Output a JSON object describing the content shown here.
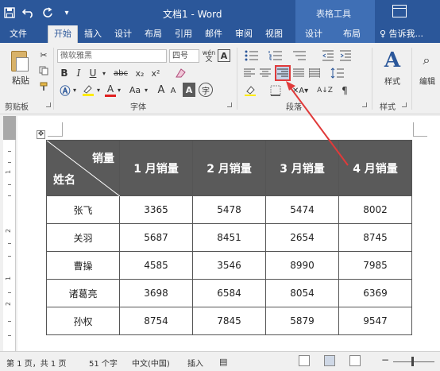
{
  "titlebar": {
    "doc_title": "文档1 - Word",
    "context_title": "表格工具",
    "qat_icons": [
      "save-icon",
      "undo-icon",
      "redo-icon",
      "qat-more-icon"
    ]
  },
  "tabs": [
    "文件",
    "开始",
    "插入",
    "设计",
    "布局",
    "引用",
    "邮件",
    "审阅",
    "视图",
    "设计",
    "布局"
  ],
  "tell_me": "♀ 告诉我...",
  "ribbon": {
    "paste_label": "粘贴",
    "font_name": "微软雅黑",
    "font_size": "四号",
    "bold": "B",
    "italic": "I",
    "underline": "U",
    "strike": "abc",
    "subscript": "x₂",
    "superscript": "x²",
    "font_color_letter": "A",
    "aa_label": "Aa",
    "grow_font": "A",
    "shrink_font": "A",
    "char_border": "A",
    "enclose_char": "字",
    "phonetic": "wén",
    "styles_label": "样式",
    "edit_label": "编辑",
    "groups": {
      "clipboard": "剪贴板",
      "font": "字体",
      "paragraph": "段落",
      "styles": "样式"
    }
  },
  "table": {
    "diag_top": "销量",
    "diag_bottom": "姓名",
    "headers": [
      "1 月销量",
      "2 月销量",
      "3 月销量",
      "4 月销量"
    ],
    "rows": [
      {
        "name": "张飞",
        "values": [
          "3365",
          "5478",
          "5474",
          "8002"
        ]
      },
      {
        "name": "关羽",
        "values": [
          "5687",
          "8451",
          "2654",
          "8745"
        ]
      },
      {
        "name": "曹操",
        "values": [
          "4585",
          "3546",
          "8990",
          "7985"
        ]
      },
      {
        "name": "诸葛亮",
        "values": [
          "3698",
          "6584",
          "8054",
          "6369"
        ]
      },
      {
        "name": "孙权",
        "values": [
          "8754",
          "7845",
          "5879",
          "9547"
        ]
      }
    ]
  },
  "ruler": {
    "numbers": [
      "1",
      "2",
      "1",
      "2"
    ]
  },
  "statusbar": {
    "page": "第 1 页，共 1 页",
    "words": "51 个字",
    "language": "中文(中国)",
    "mode": "插入"
  },
  "colors": {
    "brand": "#2b579a",
    "header_fill": "#5a5a5a",
    "highlight": "#e03a3a"
  }
}
